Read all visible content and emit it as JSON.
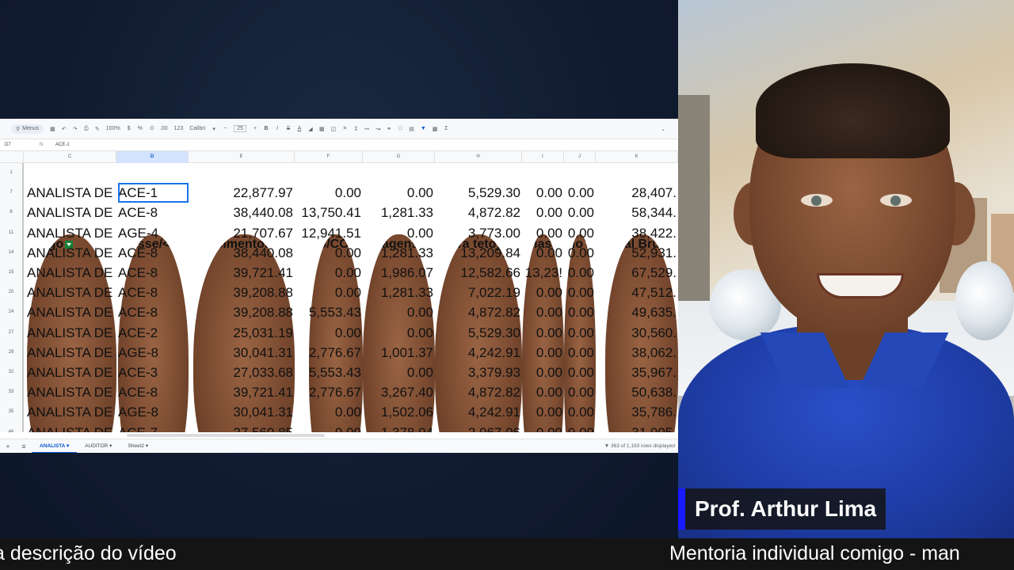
{
  "toolbar": {
    "search_label": "Menus",
    "zoom": "100%",
    "font": "Calibri",
    "font_size": "25",
    "currency": "$",
    "percent": "%",
    "decimal_less": ".0",
    "decimal_more": ".00",
    "number_format": "123"
  },
  "formula_bar": {
    "cell_ref": "D7",
    "fx": "fx",
    "value": "ACE-1"
  },
  "columns": [
    "C",
    "D",
    "E",
    "F",
    "G",
    "H",
    "I",
    "J",
    "K"
  ],
  "headers": [
    "Cargo",
    "Classe/<l",
    "Vencimentos",
    "FG/CC",
    "antagens",
    "(extra teto)",
    "érias",
    "nio",
    "Total Brut"
  ],
  "rows": [
    {
      "num": "7",
      "cells": [
        "ANALISTA DE",
        "ACE-1",
        "22,877.97",
        "0.00",
        "0.00",
        "5,529.30",
        "0.00",
        "0.00",
        "28,407."
      ]
    },
    {
      "num": "8",
      "cells": [
        "ANALISTA DE",
        "ACE-8",
        "38,440.08",
        "13,750.41",
        "1,281.33",
        "4,872.82",
        "0.00",
        "0.00",
        "58,344."
      ]
    },
    {
      "num": "11",
      "cells": [
        "ANALISTA DE",
        "AGE-4",
        "21,707.67",
        "12,941.51",
        "0.00",
        "3,773.00",
        "0.00",
        "0.00",
        "38,422."
      ]
    },
    {
      "num": "14",
      "cells": [
        "ANALISTA DE",
        "ACE-8",
        "38,440.08",
        "0.00",
        "1,281.33",
        "13,209.84",
        "0.00",
        "0.00",
        "52,931."
      ]
    },
    {
      "num": "15",
      "cells": [
        "ANALISTA DE",
        "ACE-8",
        "39,721.41",
        "0.00",
        "1,986.07",
        "12,582.66",
        "13,23!",
        "0.00",
        "67,529."
      ]
    },
    {
      "num": "20",
      "cells": [
        "ANALISTA DE",
        "ACE-8",
        "39,208.88",
        "0.00",
        "1,281.33",
        "7,022.19",
        "0.00",
        "0.00",
        "47,512."
      ]
    },
    {
      "num": "24",
      "cells": [
        "ANALISTA DE",
        "ACE-8",
        "39,208.88",
        "5,553.43",
        "0.00",
        "4,872.82",
        "0.00",
        "0.00",
        "49,635."
      ]
    },
    {
      "num": "27",
      "cells": [
        "ANALISTA DE",
        "ACE-2",
        "25,031.19",
        "0.00",
        "0.00",
        "5,529.30",
        "0.00",
        "0.00",
        "30,560."
      ]
    },
    {
      "num": "29",
      "cells": [
        "ANALISTA DE",
        "AGE-8",
        "30,041.31",
        "2,776.67",
        "1,001.37",
        "4,242.91",
        "0.00",
        "0.00",
        "38,062."
      ]
    },
    {
      "num": "32",
      "cells": [
        "ANALISTA DE",
        "ACE-3",
        "27,033.68",
        "5,553.43",
        "0.00",
        "3,379.93",
        "0.00",
        "0.00",
        "35,967."
      ]
    },
    {
      "num": "33",
      "cells": [
        "ANALISTA DE",
        "ACE-8",
        "39,721.41",
        "2,776.67",
        "3,267.40",
        "4,872.82",
        "0.00",
        "0.00",
        "50,638."
      ]
    },
    {
      "num": "35",
      "cells": [
        "ANALISTA DE",
        "AGE-8",
        "30,041.31",
        "0.00",
        "1,502.06",
        "4,242.91",
        "0.00",
        "0.00",
        "35,786."
      ]
    },
    {
      "num": "46",
      "cells": [
        "ANALISTA DE",
        "ACE-7",
        "27,560.85",
        "0.00",
        "1,378.04",
        "2,967.06",
        "0.00",
        "0.00",
        "31,905."
      ]
    }
  ],
  "sheet_tabs": [
    "ANALISTA",
    "AUDITOR",
    "Sheet2"
  ],
  "row_count": "363 of 1,193 rows displayed",
  "presenter": "Prof. Arthur Lima",
  "ticker": {
    "left": "a descrição do vídeo",
    "right": "Mentoria individual comigo - man"
  },
  "colors": {
    "accent": "#1a1aff",
    "filter_active": "#188038",
    "selection": "#1a73e8"
  }
}
